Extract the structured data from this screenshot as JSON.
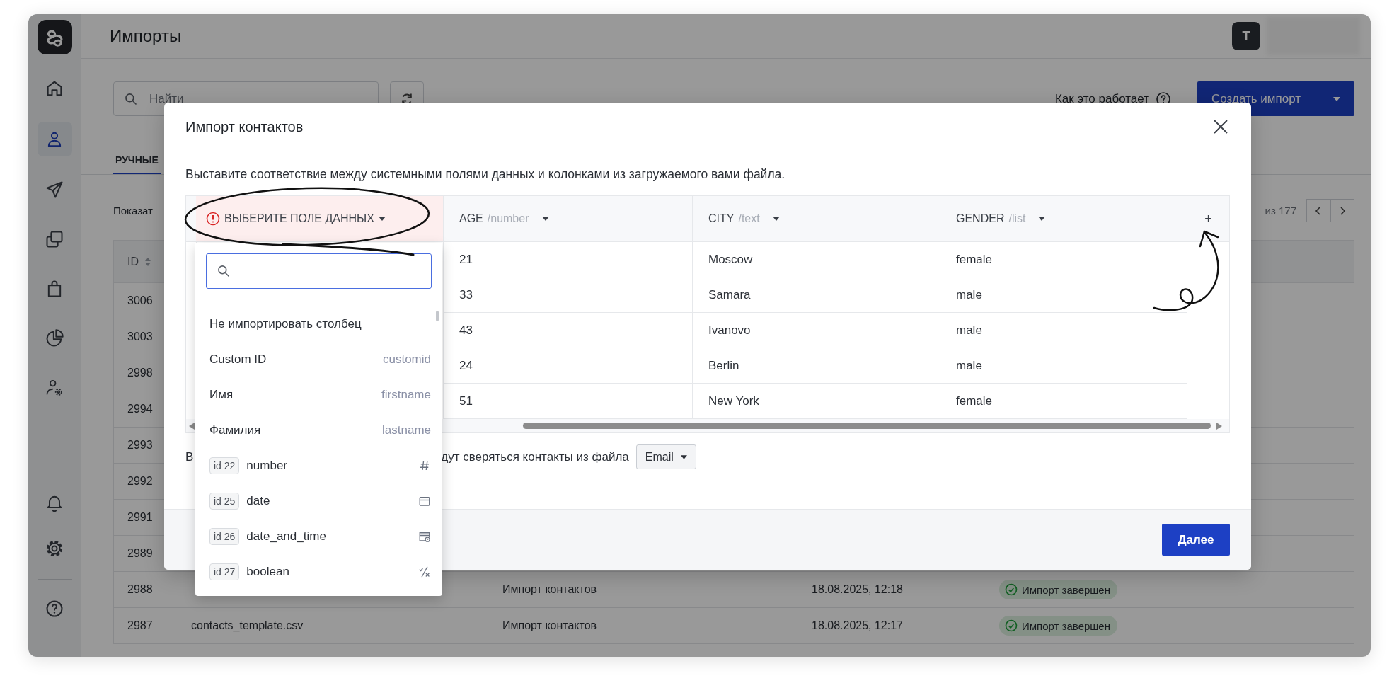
{
  "sidebar": {
    "items": [
      {
        "kind": "home",
        "selected": false
      },
      {
        "kind": "contacts",
        "selected": true
      },
      {
        "kind": "send",
        "selected": false
      },
      {
        "kind": "copy",
        "selected": false
      },
      {
        "kind": "bag",
        "selected": false
      },
      {
        "kind": "chart",
        "selected": false
      },
      {
        "kind": "user_settings",
        "selected": false
      }
    ],
    "bottom_items": [
      {
        "kind": "bell",
        "selected": false
      },
      {
        "kind": "settings",
        "selected": false
      }
    ],
    "footer_items": [
      {
        "kind": "help",
        "selected": false
      }
    ]
  },
  "header": {
    "title": "Импорты",
    "avatar": "T"
  },
  "toolbar": {
    "search": {
      "placeholder": "Найти"
    },
    "help_link": "Как это работает",
    "create_button": "Создать импорт"
  },
  "tabs": [
    {
      "label": "РУЧНЫЕ",
      "selected": true
    }
  ],
  "pagination": {
    "show_label": "Показат",
    "total": "из 177"
  },
  "imports_table": {
    "columns": [
      {
        "label": "ID"
      }
    ],
    "rows": [
      {
        "id": "3006"
      },
      {
        "id": "3003"
      },
      {
        "id": "2998"
      },
      {
        "id": "2994"
      },
      {
        "id": "2993"
      },
      {
        "id": "2992"
      },
      {
        "id": "2991"
      },
      {
        "id": "2989"
      },
      {
        "id": "2988",
        "type": "Импорт контактов",
        "date": "18.08.2025, 12:18",
        "status": "Импорт завершен"
      },
      {
        "id": "2987",
        "file": "contacts_template.csv",
        "type": "Импорт контактов",
        "date": "18.08.2025, 12:17",
        "status": "Импорт завершен"
      }
    ]
  },
  "dialog": {
    "title": "Импорт контактов",
    "description": "Выставите соответствие между системными полями данных и колонками из загружаемого вами файла.",
    "mapping": {
      "columns": [
        {
          "label": "ВЫБЕРИТЕ ПОЛЕ ДАННЫХ",
          "error": true
        },
        {
          "label": "AGE",
          "type": "/number",
          "error": false
        },
        {
          "label": "CITY",
          "type": "/text",
          "error": false
        },
        {
          "label": "GENDER",
          "type": "/list",
          "error": false
        }
      ],
      "add_column": "+",
      "rows": [
        {
          "cells": [
            "",
            "21",
            "Moscow",
            "female"
          ]
        },
        {
          "cells": [
            "",
            "33",
            "Samara",
            "male"
          ]
        },
        {
          "cells": [
            "",
            "43",
            "Ivanovo",
            "male"
          ]
        },
        {
          "cells": [
            "",
            "24",
            "Berlin",
            "male"
          ]
        },
        {
          "cells": [
            "",
            "51",
            "New York",
            "female"
          ]
        }
      ]
    },
    "match": {
      "prefix": "В",
      "suffix": "дут сверяться контакты из файла",
      "field": "Email"
    },
    "next_button": "Далее",
    "dropdown": {
      "options": [
        {
          "kind": "plain",
          "label": "Не импортировать столбец"
        },
        {
          "kind": "plain",
          "label": "Custom ID",
          "key": "customid"
        },
        {
          "kind": "plain",
          "label": "Имя",
          "key": "firstname"
        },
        {
          "kind": "plain",
          "label": "Фамилия",
          "key": "lastname"
        },
        {
          "kind": "number",
          "badge": "id 22",
          "label": "number"
        },
        {
          "kind": "date",
          "badge": "id 25",
          "label": "date"
        },
        {
          "kind": "datetime",
          "badge": "id 26",
          "label": "date_and_time"
        },
        {
          "kind": "boolean",
          "badge": "id 27",
          "label": "boolean"
        }
      ]
    }
  }
}
